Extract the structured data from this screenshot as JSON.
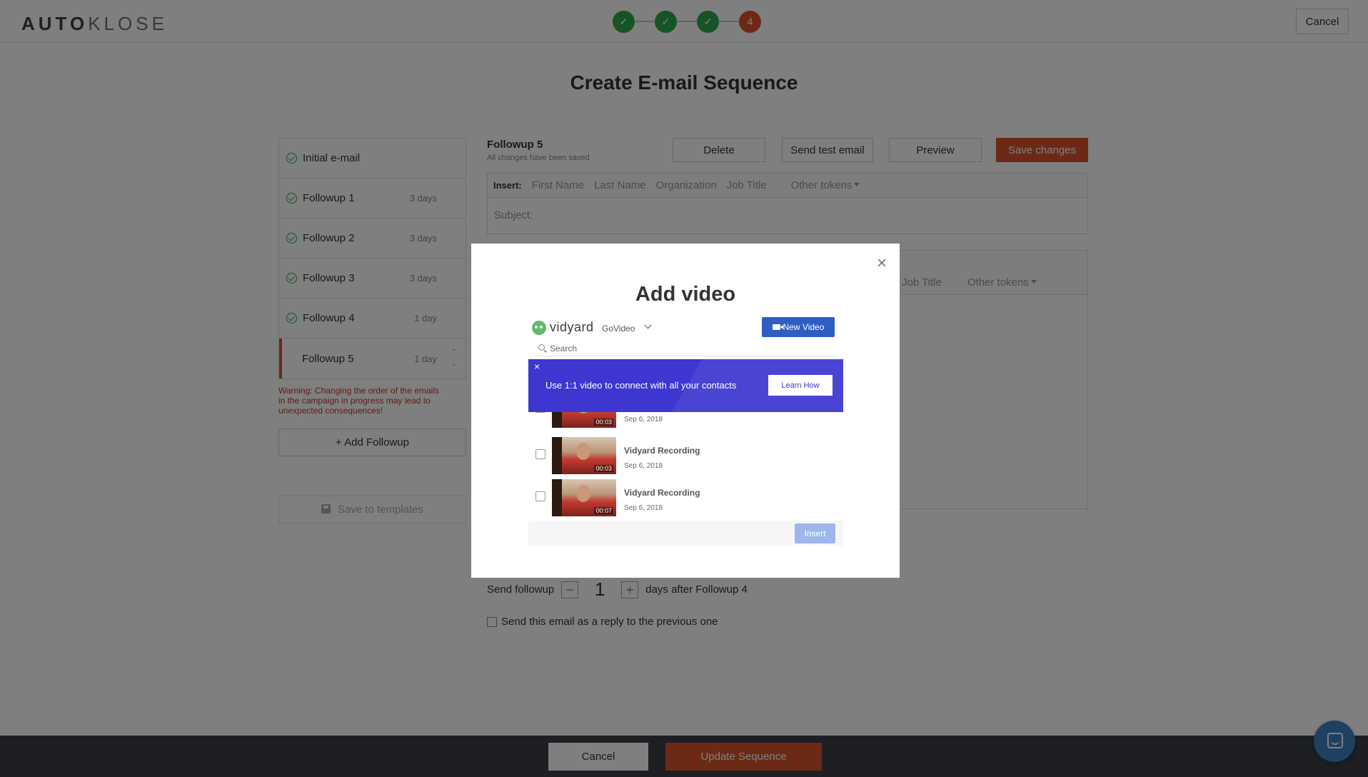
{
  "app": {
    "logo_bold": "AUTO",
    "logo_light": "KLOSE",
    "steps": [
      "✓",
      "✓",
      "✓",
      "4"
    ],
    "cancel_label": "Cancel"
  },
  "page": {
    "title": "Create E-mail Sequence"
  },
  "sequence": {
    "items": [
      {
        "name": "Initial e-mail",
        "days": ""
      },
      {
        "name": "Followup 1",
        "days": "3 days"
      },
      {
        "name": "Followup 2",
        "days": "3 days"
      },
      {
        "name": "Followup 3",
        "days": "3 days"
      },
      {
        "name": "Followup 4",
        "days": "1 day"
      },
      {
        "name": "Followup 5",
        "days": "1 day"
      }
    ],
    "warning": "Warning: Changing the order of the emails in the campaign in progress may lead to unexpected consequences!",
    "add_followup": "+ Add Followup",
    "save_templates": "Save to templates"
  },
  "editor": {
    "title": "Followup 5",
    "status": "All changes have been saved",
    "delete": "Delete",
    "send_test": "Send test email",
    "preview": "Preview",
    "save": "Save changes",
    "insert_label": "Insert:",
    "tokens": [
      "First Name",
      "Last Name",
      "Organization",
      "Job Title"
    ],
    "other_tokens": "Other tokens",
    "subject_label": "Subject:",
    "body_token_visible": "Job Title",
    "send_followup": "Send followup",
    "followup_value": "1",
    "days_after": "days after Followup 4",
    "reply_label": "Send this email as a reply to the previous one"
  },
  "footer": {
    "cancel": "Cancel",
    "update": "Update Sequence"
  },
  "modal": {
    "title": "Add video",
    "close": "×",
    "vidyard": {
      "brand": "vidyard",
      "workspace": "GoVideo",
      "new_video": "New Video",
      "search_placeholder": "Search",
      "banner_text": "Use 1:1 video to connect with all your contacts",
      "banner_close": "×",
      "learn_how": "Learn How",
      "videos": [
        {
          "name": "",
          "date": "Sep 6, 2018",
          "duration": "00:03"
        },
        {
          "name": "Vidyard Recording",
          "date": "Sep 6, 2018",
          "duration": "00:03"
        },
        {
          "name": "Vidyard Recording",
          "date": "Sep 6, 2018",
          "duration": "00:07"
        }
      ],
      "insert": "Insert"
    }
  },
  "colors": {
    "accent": "#d8532d",
    "success": "#2fa84a",
    "vidyard_blue": "#2e5ec4",
    "banner": "#3d36d0"
  }
}
